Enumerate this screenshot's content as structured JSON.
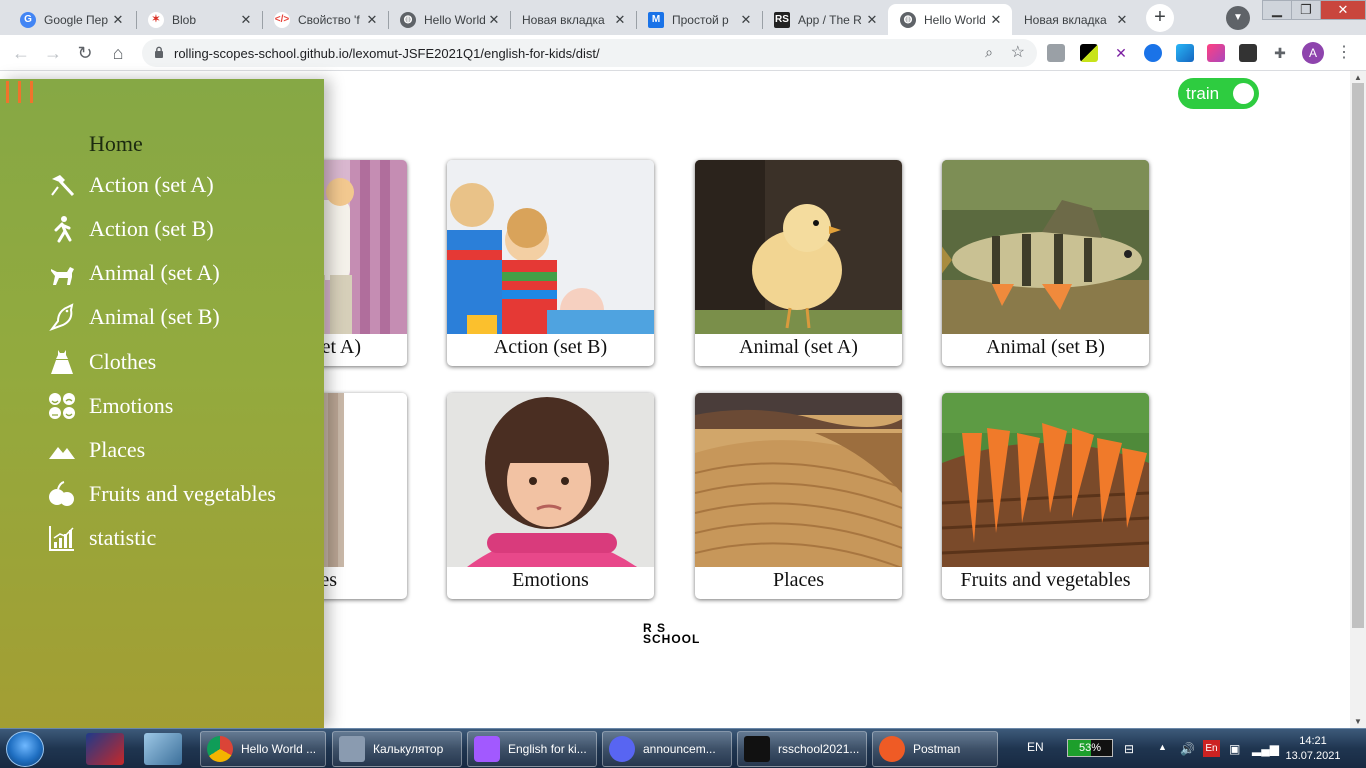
{
  "browser": {
    "tabs": [
      {
        "title": "Google Пер",
        "icon": "google-translate-icon",
        "color": "#4285f4"
      },
      {
        "title": "Blob",
        "icon": "blob-icon",
        "color": "#d93025"
      },
      {
        "title": "Свойство 'f",
        "icon": "code-icon",
        "color": "#e8453c"
      },
      {
        "title": "Hello World",
        "icon": "globe-icon",
        "color": "#5f6368"
      },
      {
        "title": "Новая вкладка",
        "icon": "",
        "color": ""
      },
      {
        "title": "Простой р",
        "icon": "gmail-icon",
        "color": "#1a73e8"
      },
      {
        "title": "App / The R",
        "icon": "rs-icon",
        "color": "#222222"
      },
      {
        "title": "Hello World",
        "icon": "globe-icon",
        "color": "#5f6368",
        "active": true
      },
      {
        "title": "Новая вкладка",
        "icon": "",
        "color": ""
      }
    ],
    "url": "rolling-scopes-school.github.io/lexomut-JSFE2021Q1/english-for-kids/dist/",
    "profile_initial": "A"
  },
  "page": {
    "mode_toggle_label": "train",
    "accent_color": "#2ecc40",
    "cards": [
      {
        "label": "Action (set A)",
        "visible_label": "et A)"
      },
      {
        "label": "Action (set B)"
      },
      {
        "label": "Animal (set A)"
      },
      {
        "label": "Animal (set B)"
      },
      {
        "label": "Clothes",
        "visible_label": "es"
      },
      {
        "label": "Emotions"
      },
      {
        "label": "Places"
      },
      {
        "label": "Fruits and vegetables"
      }
    ],
    "footer_logo": {
      "line1": "R S",
      "line2": "SCHOOL"
    }
  },
  "menu": {
    "items": [
      {
        "label": "Home",
        "icon": ""
      },
      {
        "label": "Action (set A)",
        "icon": "hammer-icon"
      },
      {
        "label": "Action (set B)",
        "icon": "running-person-icon"
      },
      {
        "label": "Animal (set A)",
        "icon": "dog-icon"
      },
      {
        "label": "Animal (set B)",
        "icon": "bird-icon"
      },
      {
        "label": "Clothes",
        "icon": "dress-icon"
      },
      {
        "label": "Emotions",
        "icon": "emotions-icon"
      },
      {
        "label": "Places",
        "icon": "mountains-icon"
      },
      {
        "label": "Fruits and vegetables",
        "icon": "apple-icon"
      },
      {
        "label": "statistic",
        "icon": "bar-chart-icon"
      }
    ]
  },
  "taskbar": {
    "tasks": [
      {
        "label": "Hello World ...",
        "color": "#db4437"
      },
      {
        "label": "Калькулятор",
        "color": "#8a9bb0"
      },
      {
        "label": "English for ki...",
        "color": "#a259ff"
      },
      {
        "label": "announcem...",
        "color": "#5865f2"
      },
      {
        "label": "rsschool2021...",
        "color": "#111111"
      },
      {
        "label": "Postman",
        "color": "#ef5b25"
      }
    ],
    "language": "EN",
    "battery_percent": 53,
    "battery_label": "53%",
    "input_lang": "En",
    "time": "14:21",
    "date": "13.07.2021"
  }
}
